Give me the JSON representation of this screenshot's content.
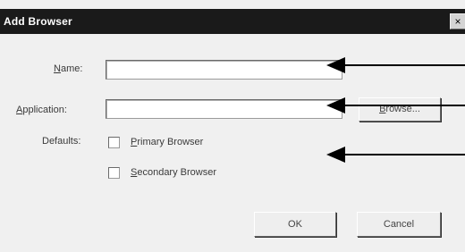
{
  "window": {
    "title": "Add Browser",
    "close_glyph": "×"
  },
  "form": {
    "name_label_u": "N",
    "name_label_rest": "ame:",
    "name_value": "",
    "application_label_u": "A",
    "application_label_rest": "pplication:",
    "application_value": "",
    "browse_label_u": "B",
    "browse_label_rest": "rowse...",
    "defaults_label": "Defaults:",
    "primary_label_u": "P",
    "primary_label_rest": "rimary Browser",
    "primary_checked": false,
    "secondary_label_u": "S",
    "secondary_label_rest": "econdary Browser",
    "secondary_checked": false
  },
  "buttons": {
    "ok": "OK",
    "cancel": "Cancel"
  },
  "annotations": {
    "arrow_icon": "arrow-left-icon",
    "arrow_color": "#000000"
  }
}
